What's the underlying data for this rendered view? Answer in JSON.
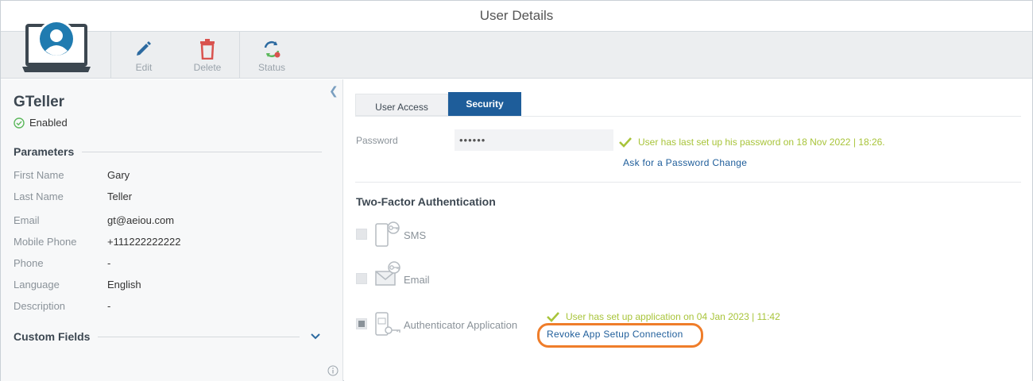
{
  "window": {
    "title": "User Details"
  },
  "toolbar": {
    "edit_label": "Edit",
    "delete_label": "Delete",
    "status_label": "Status",
    "colors": {
      "edit": "#2c6aa0",
      "delete": "#d9534f",
      "status_blue": "#2c6aa0",
      "status_green": "#5cb85c",
      "status_red": "#d9534f"
    }
  },
  "user": {
    "name": "GTeller",
    "status": "Enabled"
  },
  "parameters": {
    "title": "Parameters",
    "rows": [
      {
        "key": "First Name",
        "value": "Gary"
      },
      {
        "key": "Last Name",
        "value": "Teller"
      },
      {
        "key": "Email",
        "value": "gt@aeiou.com"
      },
      {
        "key": "Mobile Phone",
        "value": "+111222222222"
      },
      {
        "key": "Phone",
        "value": "-"
      },
      {
        "key": "Language",
        "value": "English"
      },
      {
        "key": "Description",
        "value": "-"
      }
    ]
  },
  "custom_fields": {
    "title": "Custom Fields"
  },
  "tabs": [
    {
      "label": "User Access",
      "active": false
    },
    {
      "label": "Security",
      "active": true
    }
  ],
  "security": {
    "password_label": "Password",
    "password_value": "••••••",
    "password_msg": "User has last set up his password on 18 Nov 2022 | 18:26.",
    "password_change_link": "Ask for a Password Change",
    "tfa_title": "Two-Factor Authentication",
    "methods": [
      {
        "label": "SMS",
        "checked": false,
        "icon": "phone-key-icon"
      },
      {
        "label": "Email",
        "checked": false,
        "icon": "envelope-key-icon"
      },
      {
        "label": "Authenticator Application",
        "checked": true,
        "icon": "authenticator-key-icon"
      }
    ],
    "app_msg": "User has set up application on 04 Jan 2023 | 11:42",
    "revoke_link": "Revoke App Setup Connection"
  },
  "colors": {
    "accent": "#1e5d9a",
    "success": "#a8c43a",
    "highlight": "#ef7d2a"
  }
}
